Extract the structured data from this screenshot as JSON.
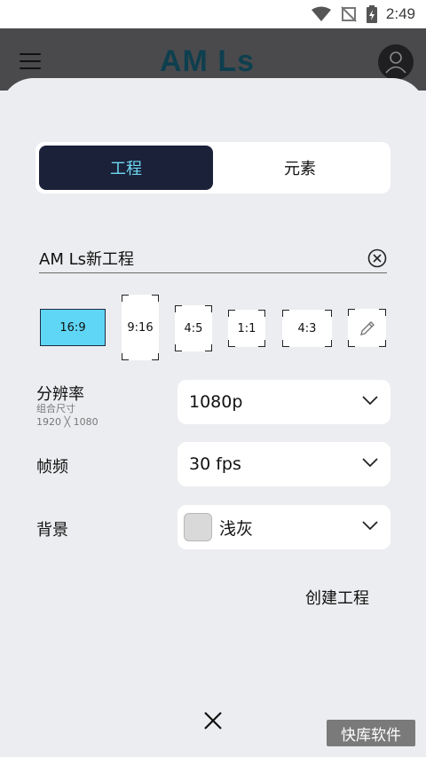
{
  "status_bar": {
    "time": "2:49"
  },
  "app_bar": {
    "logo_text": "AM Ls"
  },
  "tabs": [
    {
      "label": "工程",
      "active": true
    },
    {
      "label": "元素",
      "active": false
    }
  ],
  "project_name": {
    "value": "AM Ls新工程"
  },
  "ratios": [
    {
      "label": "16:9",
      "selected": true
    },
    {
      "label": "9:16",
      "selected": false
    },
    {
      "label": "4:5",
      "selected": false
    },
    {
      "label": "1:1",
      "selected": false
    },
    {
      "label": "4:3",
      "selected": false
    },
    {
      "label": "",
      "icon": "pencil-icon",
      "selected": false
    }
  ],
  "resolution": {
    "label": "分辨率",
    "sub_label": "组合尺寸",
    "size": "1920 ╳ 1080",
    "value": "1080p"
  },
  "frame_rate": {
    "label": "帧频",
    "value": "30 fps"
  },
  "background": {
    "label": "背景",
    "value": "浅灰",
    "swatch_color": "#d9d9d9"
  },
  "create_button": "创建工程",
  "watermark": "快库软件",
  "colors": {
    "accent": "#5fd6f5",
    "tab_active_bg": "#1a2139",
    "tab_active_text": "#6fd8f2",
    "sheet_bg": "#ecedf0"
  }
}
